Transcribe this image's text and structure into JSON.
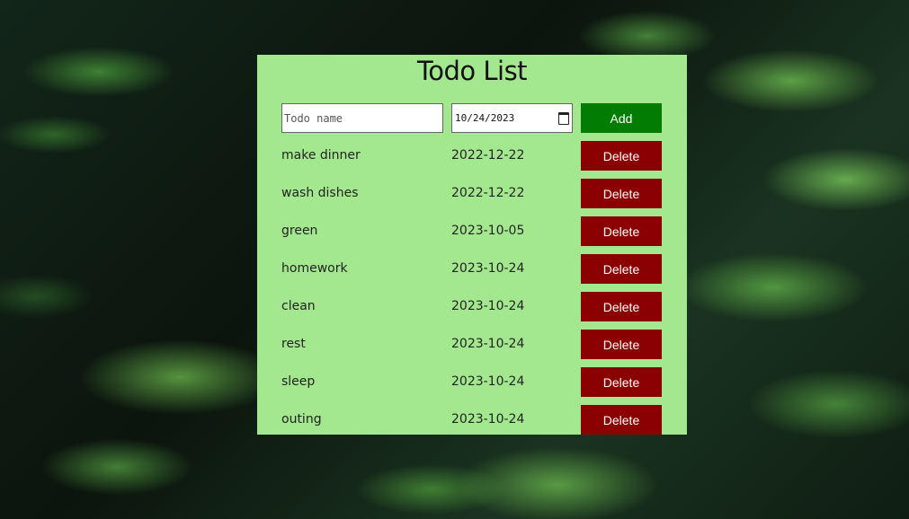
{
  "app": {
    "title": "Todo List"
  },
  "form": {
    "name_placeholder": "Todo name",
    "name_value": "",
    "date_value": "10/24/2023",
    "add_label": "Add"
  },
  "todos": [
    {
      "name": "make dinner",
      "date": "2022-12-22",
      "delete_label": "Delete"
    },
    {
      "name": "wash dishes",
      "date": "2022-12-22",
      "delete_label": "Delete"
    },
    {
      "name": "green",
      "date": "2023-10-05",
      "delete_label": "Delete"
    },
    {
      "name": "homework",
      "date": "2023-10-24",
      "delete_label": "Delete"
    },
    {
      "name": "clean",
      "date": "2023-10-24",
      "delete_label": "Delete"
    },
    {
      "name": "rest",
      "date": "2023-10-24",
      "delete_label": "Delete"
    },
    {
      "name": "sleep",
      "date": "2023-10-24",
      "delete_label": "Delete"
    },
    {
      "name": "outing",
      "date": "2023-10-24",
      "delete_label": "Delete"
    }
  ],
  "colors": {
    "card_bg": "#a3e88f",
    "add_button": "#027c02",
    "delete_button": "#8b0000"
  },
  "icons": {
    "date_picker": "calendar-icon"
  }
}
